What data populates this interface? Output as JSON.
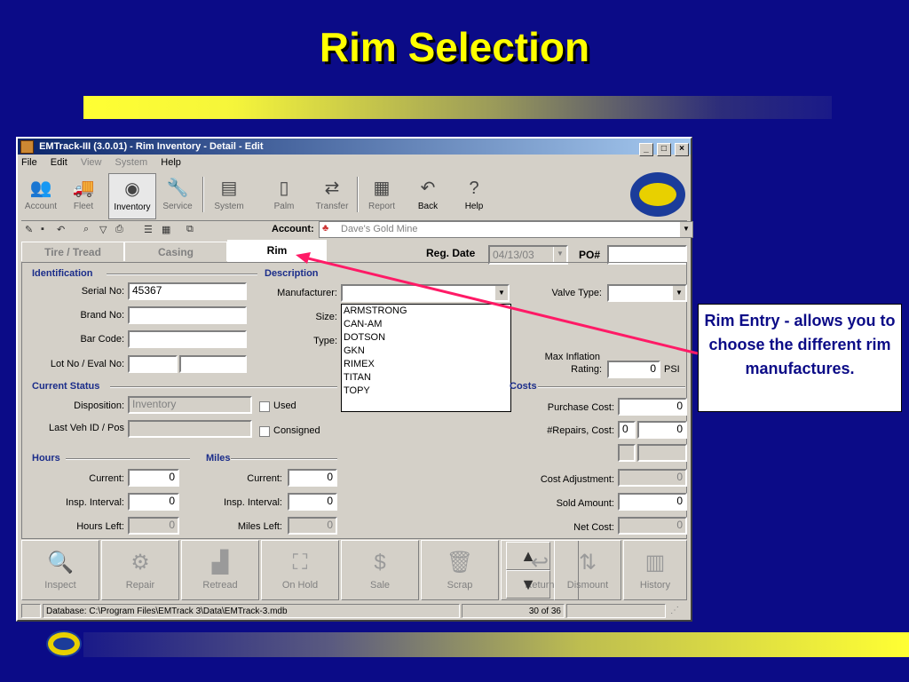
{
  "slide": {
    "title": "Rim Selection",
    "callout_text": "Rim Entry - allows you to choose the different rim manufactures."
  },
  "window": {
    "title": "EMTrack-III (3.0.01) - Rim Inventory - Detail - Edit",
    "controls": [
      "_",
      "□",
      "×"
    ],
    "menu": [
      {
        "label": "File",
        "enabled": true
      },
      {
        "label": "Edit",
        "enabled": true
      },
      {
        "label": "View",
        "enabled": false
      },
      {
        "label": "System",
        "enabled": false
      },
      {
        "label": "Help",
        "enabled": true
      }
    ],
    "toolbar": [
      {
        "label": "Account",
        "icon": "account-icon",
        "glyph": "👥"
      },
      {
        "label": "Fleet",
        "icon": "fleet-icon",
        "glyph": "🚚"
      },
      {
        "label": "Inventory",
        "icon": "inventory-icon",
        "glyph": "◉"
      },
      {
        "label": "Service",
        "icon": "service-icon",
        "glyph": "🔧"
      },
      {
        "label": "System",
        "icon": "system-icon",
        "glyph": "▤"
      },
      {
        "label": "Palm",
        "icon": "palm-icon",
        "glyph": "▯"
      },
      {
        "label": "Transfer",
        "icon": "transfer-icon",
        "glyph": "⇄"
      },
      {
        "label": "Report",
        "icon": "report-icon",
        "glyph": "▦"
      },
      {
        "label": "Back",
        "icon": "back-icon",
        "glyph": "↶"
      },
      {
        "label": "Help",
        "icon": "help-icon",
        "glyph": "?"
      }
    ],
    "account": {
      "label": "Account:",
      "value": "Dave's Gold Mine"
    },
    "tabs": [
      {
        "label": "Tire / Tread",
        "active": false
      },
      {
        "label": "Casing",
        "active": false
      },
      {
        "label": "Rim",
        "active": true
      }
    ],
    "reg_date": {
      "label": "Reg. Date",
      "value": "04/13/03"
    },
    "po": {
      "label": "PO#",
      "value": ""
    },
    "identification": {
      "title": "Identification",
      "serial_no_label": "Serial No:",
      "serial_no": "45367",
      "brand_no_label": "Brand No:",
      "bar_code_label": "Bar Code:",
      "lot_eval_label": "Lot No / Eval No:"
    },
    "description": {
      "title": "Description",
      "manufacturer_label": "Manufacturer:",
      "size_label": "Size:",
      "type_label": "Type:",
      "valve_type_label": "Valve Type:",
      "max_inflation_label": "Max Inflation",
      "rating_label": "Rating:",
      "rating_value": "0",
      "rating_unit": "PSI",
      "manufacturer_options": [
        "ARMSTRONG",
        "CAN-AM",
        "DOTSON",
        "GKN",
        "RIMEX",
        "TITAN",
        "TOPY"
      ]
    },
    "current_status": {
      "title": "Current Status",
      "disposition_label": "Disposition:",
      "disposition": "Inventory",
      "last_veh_label": "Last Veh ID / Pos",
      "used_label": "Used",
      "consigned_label": "Consigned"
    },
    "costs": {
      "title": "Costs",
      "purchase_label": "Purchase Cost:",
      "purchase": "0",
      "repairs_label": "#Repairs, Cost:",
      "repairs_count": "0",
      "repairs_cost": "0",
      "adjustment_label": "Cost Adjustment:",
      "adjustment": "0",
      "sold_label": "Sold Amount:",
      "sold": "0",
      "net_label": "Net Cost:",
      "net": "0"
    },
    "hours": {
      "title": "Hours",
      "current_label": "Current:",
      "current": "0",
      "interval_label": "Insp. Interval:",
      "interval": "0",
      "left_label": "Hours Left:",
      "left": "0"
    },
    "miles": {
      "title": "Miles",
      "current_label": "Current:",
      "current": "0",
      "interval_label": "Insp. Interval:",
      "interval": "0",
      "left_label": "Miles Left:",
      "left": "0"
    },
    "actions": [
      {
        "label": "Inspect",
        "icon": "inspect-icon",
        "glyph": "🔍"
      },
      {
        "label": "Repair",
        "icon": "repair-icon",
        "glyph": "⚙"
      },
      {
        "label": "Retread",
        "icon": "retread-icon",
        "glyph": "▟"
      },
      {
        "label": "On Hold",
        "icon": "on-hold-icon",
        "glyph": "⛶"
      },
      {
        "label": "Sale",
        "icon": "sale-icon",
        "glyph": "$"
      },
      {
        "label": "Scrap",
        "icon": "scrap-icon",
        "glyph": "🗑"
      },
      {
        "label": "Return",
        "icon": "return-icon",
        "glyph": "↩"
      },
      {
        "label": "Dismount",
        "icon": "dismount-icon",
        "glyph": "⇅"
      },
      {
        "label": "History",
        "icon": "history-icon",
        "glyph": "▥"
      }
    ],
    "status": {
      "database": "Database: C:\\Program Files\\EMTrack 3\\Data\\EMTrack-3.mdb",
      "record": "30 of 36"
    }
  },
  "colors": {
    "slide_background": "#0b0b87",
    "title_yellow": "#ffff00",
    "pointer_line": "#ff1a66",
    "window_face": "#d4d0c8"
  }
}
